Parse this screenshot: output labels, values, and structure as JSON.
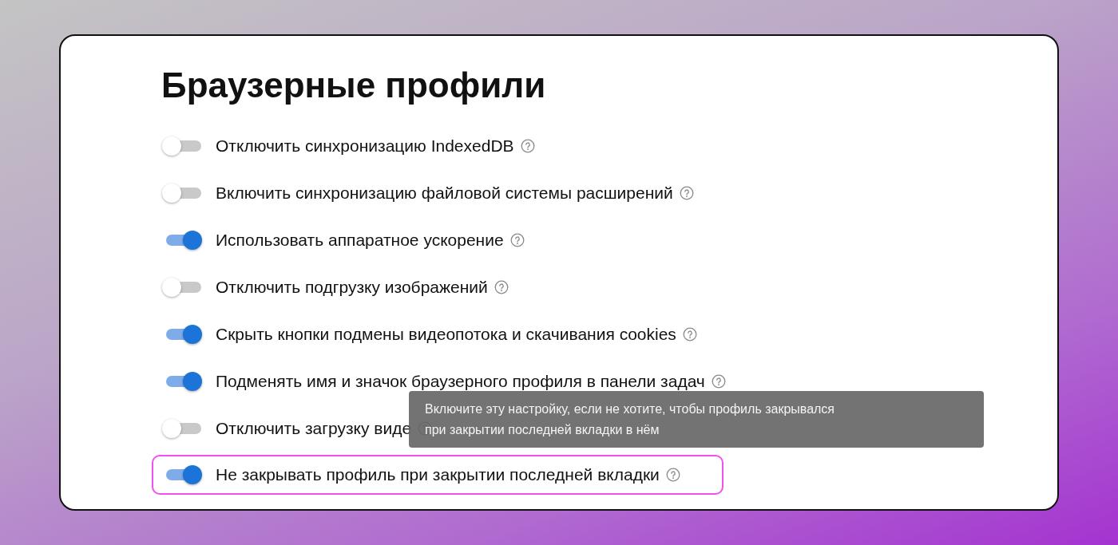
{
  "title": "Браузерные профили",
  "settings": [
    {
      "label": "Отключить синхронизацию IndexedDB",
      "on": false,
      "highlighted": false
    },
    {
      "label": "Включить синхронизацию файловой системы расширений",
      "on": false,
      "highlighted": false
    },
    {
      "label": "Использовать аппаратное ускорение",
      "on": true,
      "highlighted": false
    },
    {
      "label": "Отключить подгрузку изображений",
      "on": false,
      "highlighted": false
    },
    {
      "label": "Скрыть кнопки подмены видеопотока и скачивания cookies",
      "on": true,
      "highlighted": false
    },
    {
      "label": "Подменять имя и значок браузерного профиля в панели задач",
      "on": true,
      "highlighted": false
    },
    {
      "label": "Отключить загрузку виде",
      "on": false,
      "highlighted": false
    },
    {
      "label": "Не закрывать профиль при закрытии последней вкладки",
      "on": true,
      "highlighted": true
    }
  ],
  "tooltip": {
    "lines": [
      "Включите эту настройку, если не хотите, чтобы профиль закрывался",
      "при закрытии последней вкладки в нём"
    ]
  }
}
